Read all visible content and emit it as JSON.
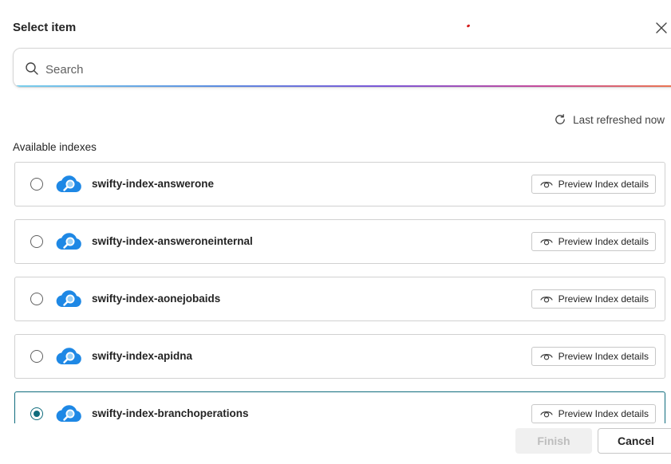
{
  "dialog": {
    "title": "Select item",
    "close_icon": "close-icon"
  },
  "search": {
    "placeholder": "Search",
    "value": "",
    "icon": "search-icon"
  },
  "refresh": {
    "label": "Last refreshed now",
    "icon": "refresh-icon"
  },
  "section": {
    "label": "Available indexes"
  },
  "indexes": [
    {
      "name": "swifty-index-answerone",
      "selected": false,
      "preview_label": "Preview Index details"
    },
    {
      "name": "swifty-index-answeroneinternal",
      "selected": false,
      "preview_label": "Preview Index details"
    },
    {
      "name": "swifty-index-aonejobaids",
      "selected": false,
      "preview_label": "Preview Index details"
    },
    {
      "name": "swifty-index-apidna",
      "selected": false,
      "preview_label": "Preview Index details"
    },
    {
      "name": "swifty-index-branchoperations",
      "selected": true,
      "preview_label": "Preview Index details"
    }
  ],
  "footer": {
    "finish_label": "Finish",
    "finish_enabled": false,
    "cancel_label": "Cancel"
  },
  "colors": {
    "accent": "#0f6c7d",
    "cloud_icon": "#1e88e5",
    "text": "#242424"
  }
}
